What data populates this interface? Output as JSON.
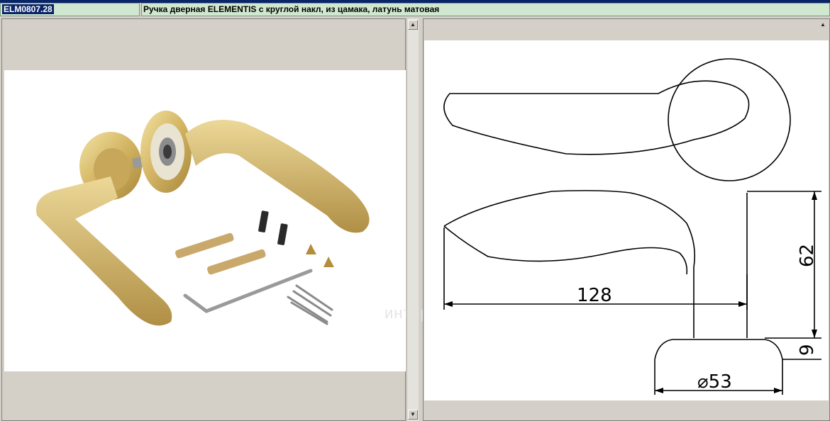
{
  "header": {
    "code": "ELM0807.28",
    "title": "Ручка дверная ELEMENTIS с круглой накл, из цамака, латунь матовая"
  },
  "icons": {
    "scroll_up": "▲",
    "scroll_down": "▼"
  },
  "drawing": {
    "dims": {
      "length": "128",
      "height": "62",
      "rose_thickness": "9",
      "rose_diameter": "⌀53"
    }
  },
  "watermark": "интернет-аукцион"
}
